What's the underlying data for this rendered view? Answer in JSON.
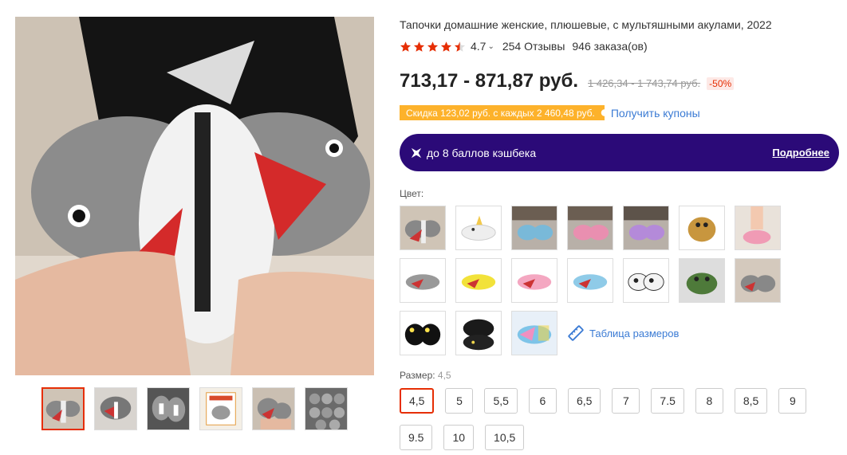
{
  "product": {
    "title": "Тапочки домашние женские, плюшевые, с мультяшными акулами, 2022",
    "rating": "4.7",
    "stars_filled": 4.5,
    "reviews": "254 Отзывы",
    "orders": "946 заказа(ов)"
  },
  "price": {
    "current": "713,17 - 871,87 руб.",
    "old": "1 426,34 - 1 743,74 руб.",
    "discount": "-50%"
  },
  "coupon": {
    "tag": "Скидка 123,02 руб. с каждых 2 460,48 руб.",
    "link": "Получить купоны"
  },
  "cashback": {
    "text": "до 8 баллов кэшбека",
    "more": "Подробнее"
  },
  "colors": {
    "label": "Цвет:",
    "size_table": "Таблица размеров",
    "icons": [
      "ruler-icon",
      "star-icon",
      "chevron-down-icon",
      "cashback-icon"
    ]
  },
  "sizes": {
    "label": "Размер:",
    "selected": "4,5",
    "options": [
      "4,5",
      "5",
      "5,5",
      "6",
      "6,5",
      "7",
      "7.5",
      "8",
      "8,5",
      "9",
      "9.5",
      "10",
      "10,5"
    ]
  },
  "theme": {
    "accent": "#e62e04",
    "link": "#3b7bd4",
    "cashback_bg": "#2b0a78",
    "coupon_bg": "#fdb22b"
  }
}
